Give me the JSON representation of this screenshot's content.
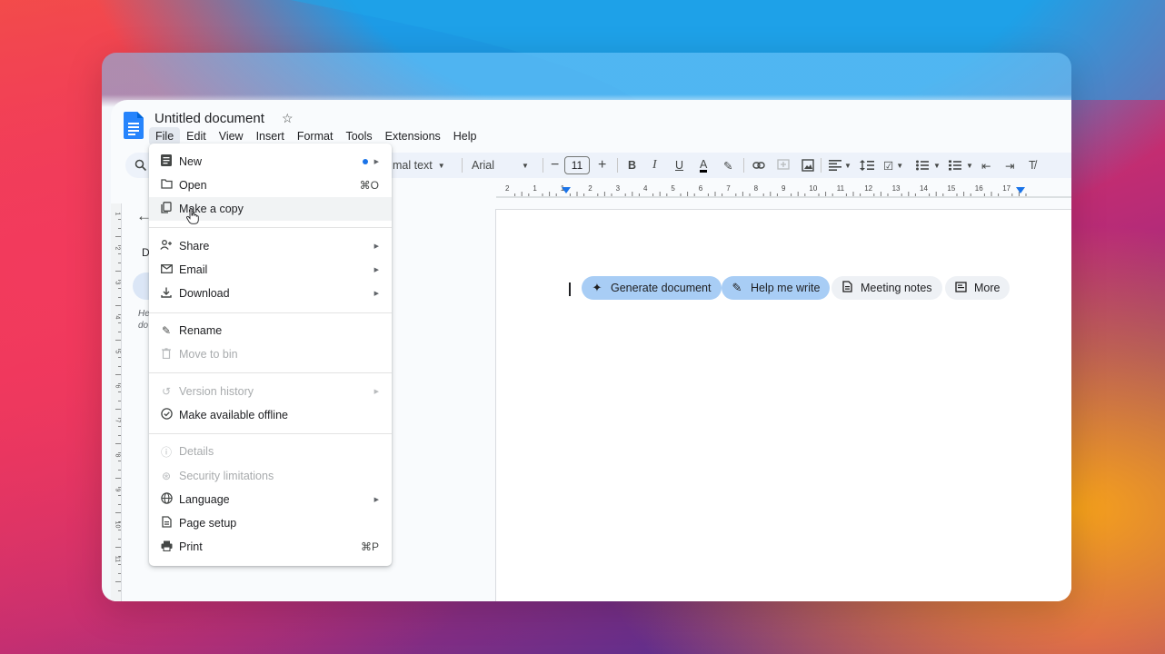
{
  "header": {
    "title": "Untitled document",
    "menus": [
      "File",
      "Edit",
      "View",
      "Insert",
      "Format",
      "Tools",
      "Extensions",
      "Help"
    ]
  },
  "toolbar": {
    "style_value": "mal text",
    "font_value": "Arial",
    "font_size": "11"
  },
  "ruler": {
    "ticks": [
      "2",
      "1",
      "1",
      "2",
      "3",
      "4",
      "5",
      "6",
      "7",
      "8",
      "9",
      "10",
      "11",
      "12",
      "13",
      "14",
      "15",
      "16",
      "17"
    ]
  },
  "left_panel": {
    "heading_fragment": "D",
    "text_fragment_1": "He",
    "text_fragment_2": "do"
  },
  "vertical_ruler": [
    "1",
    "2",
    "3",
    "4",
    "5",
    "6",
    "7",
    "8",
    "9",
    "10",
    "11"
  ],
  "page": {
    "chips": [
      {
        "label": "Generate document",
        "icon": "sparkle-icon"
      },
      {
        "label": "Help me write",
        "icon": "magic-pen-icon"
      },
      {
        "label": "Meeting notes",
        "icon": "document-icon"
      },
      {
        "label": "More",
        "icon": "note-icon"
      }
    ]
  },
  "file_menu": {
    "new": "New",
    "open": "Open",
    "open_shortcut": "⌘O",
    "make_copy": "Make a copy",
    "share": "Share",
    "email": "Email",
    "download": "Download",
    "rename": "Rename",
    "move_to_bin": "Move to bin",
    "version_history": "Version history",
    "make_offline": "Make available offline",
    "details": "Details",
    "security": "Security limitations",
    "language": "Language",
    "page_setup": "Page setup",
    "print": "Print",
    "print_shortcut": "⌘P"
  },
  "colors": {
    "accent": "#1a73e8",
    "ai_chip": "#a8cdf5",
    "toolbar_bg": "#edf2fa"
  }
}
